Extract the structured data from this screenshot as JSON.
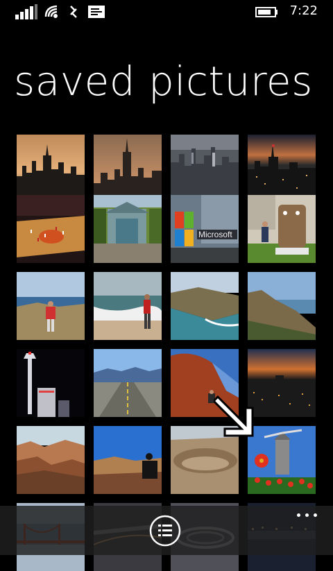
{
  "status_bar": {
    "time": "7:22"
  },
  "page": {
    "title": "saved pictures"
  },
  "photos": [
    {
      "subject": "city skyline at dusk"
    },
    {
      "subject": "empire state building"
    },
    {
      "subject": "city aerial"
    },
    {
      "subject": "city night"
    },
    {
      "subject": "basketball arena"
    },
    {
      "subject": "green garage"
    },
    {
      "subject": "microsoft building"
    },
    {
      "subject": "android statue"
    },
    {
      "subject": "coastal rock"
    },
    {
      "subject": "beach"
    },
    {
      "subject": "coastline"
    },
    {
      "subject": "cliff coast"
    },
    {
      "subject": "tower night"
    },
    {
      "subject": "road desert"
    },
    {
      "subject": "red rock"
    },
    {
      "subject": "city night"
    },
    {
      "subject": "canyon"
    },
    {
      "subject": "canyon silhouette"
    },
    {
      "subject": "crater"
    },
    {
      "subject": "windmill tulips"
    },
    {
      "subject": "bridge"
    },
    {
      "subject": "highway"
    },
    {
      "subject": "interchange"
    },
    {
      "subject": "waterfront night"
    }
  ],
  "app_bar": {
    "icons": [
      "list-icon"
    ],
    "more_label": "..."
  }
}
